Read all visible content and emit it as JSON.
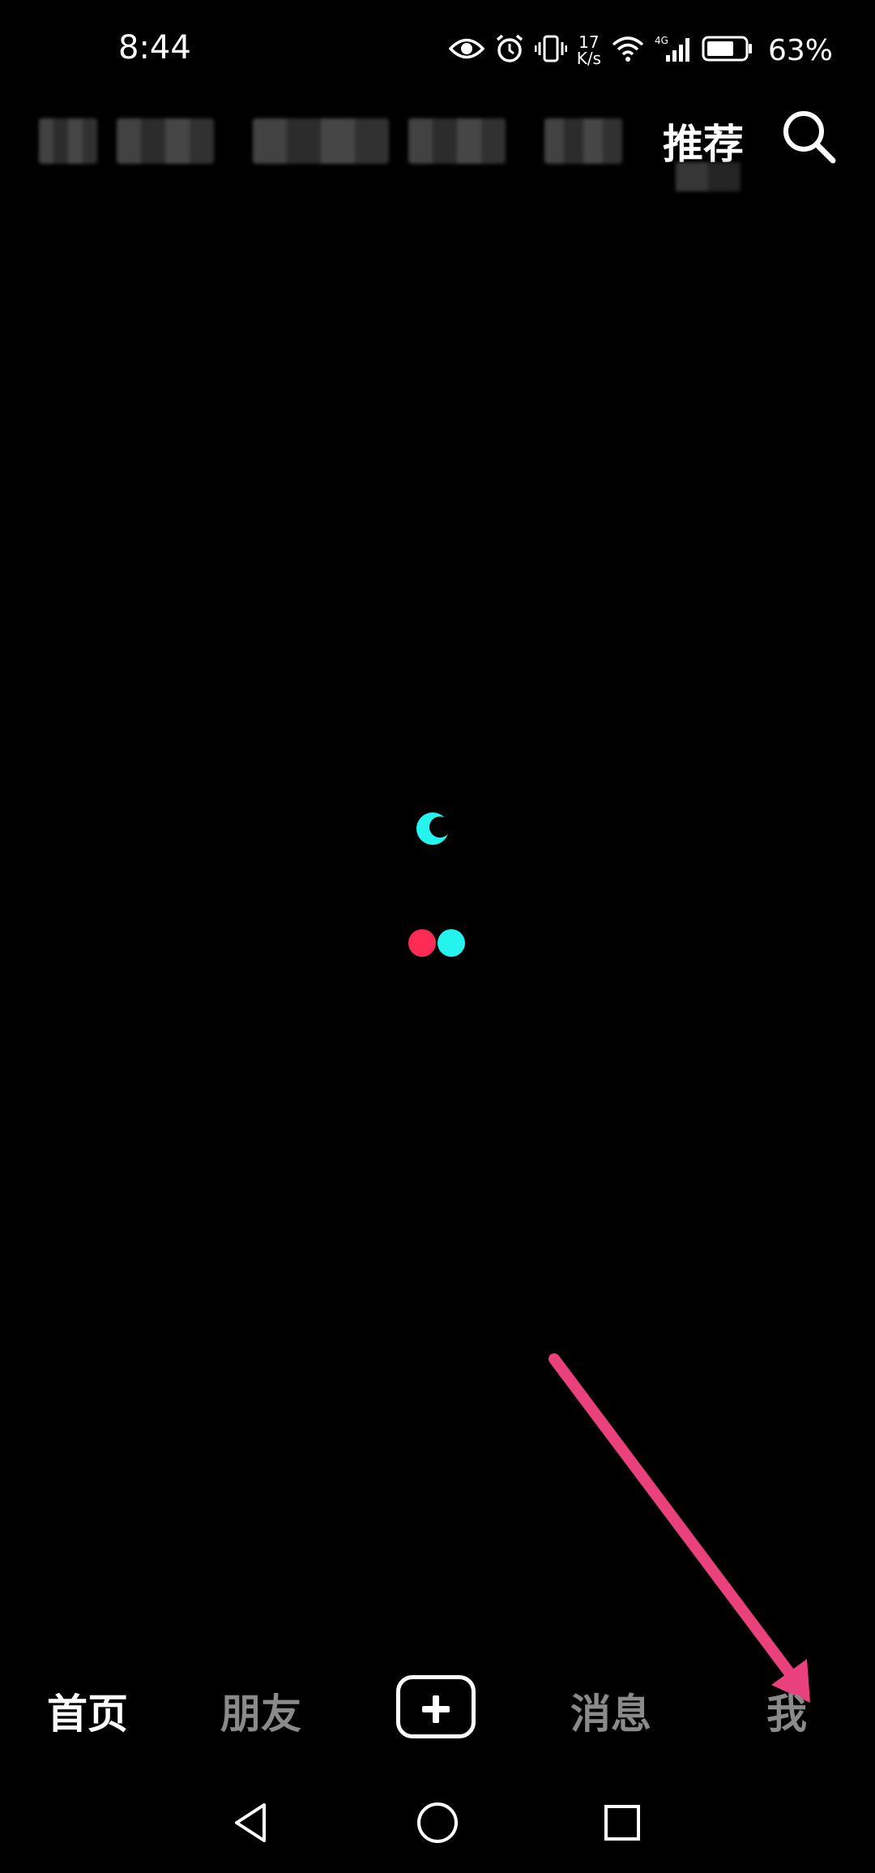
{
  "status_bar": {
    "time": "8:44",
    "net_speed_value": "17",
    "net_speed_unit": "K/s",
    "signal_type": "4G",
    "battery_percent": "63%"
  },
  "top_tabs": {
    "active_label": "推荐",
    "obscured_tabs": [
      "",
      "",
      "",
      "",
      ""
    ]
  },
  "loader": {
    "colors": {
      "cyan": "#25F4EE",
      "red": "#FE2C55"
    }
  },
  "bottom_nav": {
    "home": "首页",
    "friends": "朋友",
    "messages": "消息",
    "me": "我"
  },
  "annotation": {
    "arrow_color": "#E8417C"
  },
  "icons": {
    "status": [
      "eye-icon",
      "alarm-icon",
      "vibrate-icon",
      "wifi-icon",
      "cell-signal-icon",
      "battery-icon"
    ],
    "search": "search-icon",
    "system_nav": [
      "back-icon",
      "home-circle-icon",
      "recents-icon"
    ]
  }
}
